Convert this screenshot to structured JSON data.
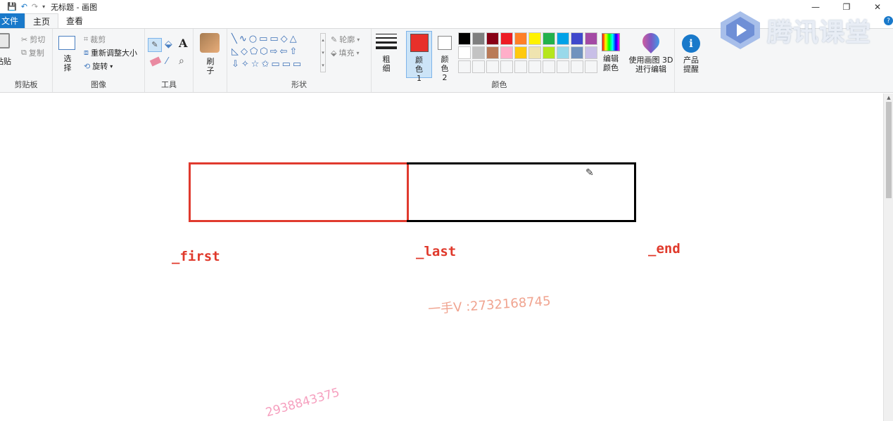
{
  "window": {
    "title": "无标题 - 画图",
    "minimize": "—",
    "restore": "❐",
    "close": "✕"
  },
  "tabs": [
    {
      "label": "文件"
    },
    {
      "label": "主页"
    },
    {
      "label": "查看"
    }
  ],
  "ribbon": {
    "clipboard": {
      "paste": "粘贴",
      "cut": "剪切",
      "copy": "复制",
      "group": "剪贴板"
    },
    "image": {
      "select": "选择",
      "crop": "裁剪",
      "resize": "重新调整大小",
      "rotate": "旋转",
      "group": "图像"
    },
    "tools": {
      "group": "工具"
    },
    "brushes": {
      "label": "刷子"
    },
    "shapes": {
      "outline": "轮廓",
      "fill": "填充",
      "group": "形状"
    },
    "size": {
      "label": "粗细"
    },
    "colors": {
      "color1": "颜色 1",
      "color2": "颜色 2",
      "edit": "编辑颜色",
      "group": "颜色",
      "color1_value": "#e8302a",
      "color2_value": "#ffffff",
      "palette": [
        "#000000",
        "#7f7f7f",
        "#880015",
        "#ed1c24",
        "#ff7f27",
        "#fff200",
        "#22b14c",
        "#00a2e8",
        "#3f48cc",
        "#a349a4",
        "#ffffff",
        "#c3c3c3",
        "#b97a57",
        "#ffaec9",
        "#ffc90e",
        "#efe4b0",
        "#b5e61d",
        "#99d9ea",
        "#7092be",
        "#c8bfe7",
        "",
        "",
        "",
        "",
        "",
        "",
        "",
        "",
        "",
        ""
      ]
    },
    "paint3d": {
      "label": "使用画图 3D 进行编辑"
    },
    "alert": {
      "label": "产品提醒"
    }
  },
  "canvas": {
    "labels": {
      "first": "_first",
      "last": "_last",
      "end": "_end"
    },
    "watermark1": "一手V :2732168745",
    "watermark2": "2938843375"
  },
  "brand": {
    "text": "腾讯课堂"
  }
}
